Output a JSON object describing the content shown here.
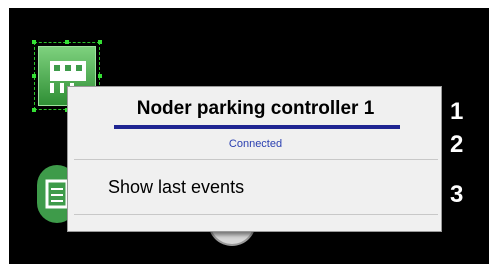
{
  "context_menu": {
    "title": "Noder parking controller 1",
    "status": "Connected",
    "items": [
      {
        "label": "Show last events"
      }
    ]
  },
  "callouts": [
    "1",
    "2",
    "3"
  ],
  "colors": {
    "background": "#000000",
    "title_underline": "#1f2592",
    "status_text": "#2a3fb0",
    "device_green": "#3e9b4a"
  }
}
